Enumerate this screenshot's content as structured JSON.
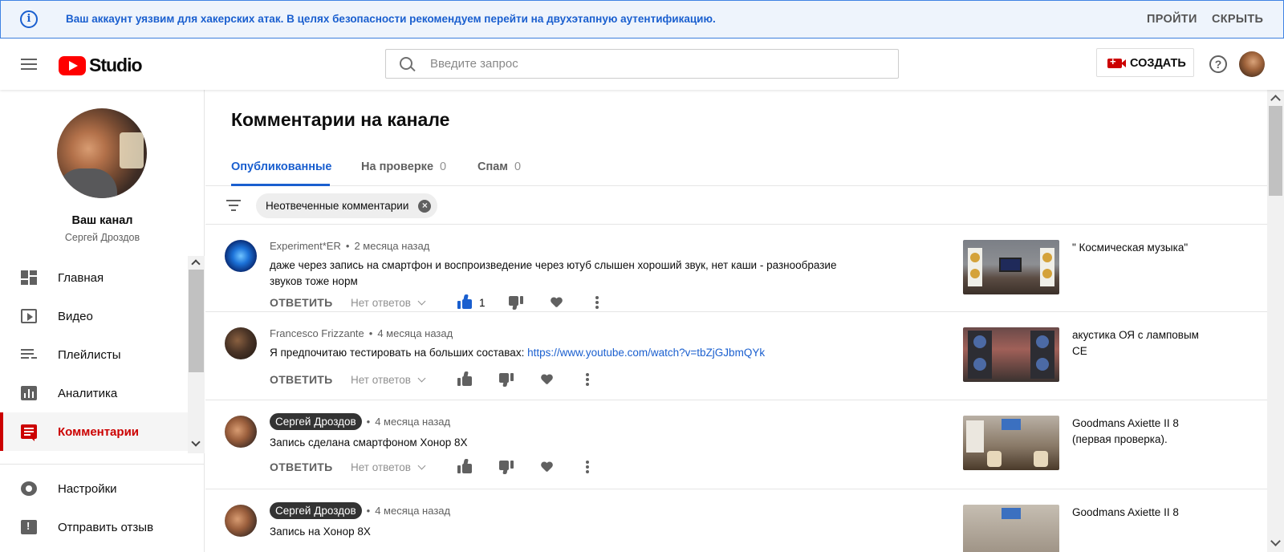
{
  "banner": {
    "message": "Ваш аккаунт уязвим для хакерских атак. В целях безопасности рекомендуем перейти на двухэтапную аутентификацию.",
    "go_label": "ПРОЙТИ",
    "hide_label": "СКРЫТЬ",
    "info_glyph": "i"
  },
  "header": {
    "logo_text": "Studio",
    "search_placeholder": "Введите запрос",
    "create_label": "СОЗДАТЬ",
    "help_glyph": "?"
  },
  "sidebar": {
    "channel_title": "Ваш канал",
    "channel_name": "Сергей Дроздов",
    "items": [
      {
        "label": "Главная"
      },
      {
        "label": "Видео"
      },
      {
        "label": "Плейлисты"
      },
      {
        "label": "Аналитика"
      },
      {
        "label": "Комментарии",
        "active": true
      }
    ],
    "bottom_items": [
      {
        "label": "Настройки"
      },
      {
        "label": "Отправить отзыв"
      }
    ]
  },
  "main": {
    "title": "Комментарии на канале",
    "tabs": [
      {
        "label": "Опубликованные",
        "count": ""
      },
      {
        "label": "На проверке",
        "count": "0"
      },
      {
        "label": "Спам",
        "count": "0"
      }
    ],
    "filter_chip": "Неотвеченные комментарии",
    "chip_close_glyph": "×",
    "reply_label": "ОТВЕТИТЬ",
    "no_replies_label": "Нет ответов",
    "comments": [
      {
        "author": "Experiment*ER",
        "time": "2 месяца назад",
        "text": "даже через запись на смартфон и воспроизведение через ютуб слышен хороший звук, нет каши - разнообразие звуков тоже норм",
        "likes": "1",
        "video_title": "\" Космическая музыка\""
      },
      {
        "author": "Francesco Frizzante",
        "time": "4 месяца назад",
        "text": "Я предпочитаю тестировать на больших составах: ",
        "link": "https://www.youtube.com/watch?v=tbZjGJbmQYk",
        "video_title": "акустика ОЯ с ламповым СЕ"
      },
      {
        "author": "Сергей Дроздов",
        "time": "4 месяца назад",
        "text": "Запись сделана смартфоном Хонор 8Х",
        "video_title": "Goodmans Axiette II 8 (первая проверка)."
      },
      {
        "author": "Сергей Дроздов",
        "time": "4 месяца назад",
        "text": "Запись на Хонор 8Х",
        "video_title": "Goodmans Axiette II 8"
      }
    ]
  },
  "colors": {
    "accent_blue": "#1a5fcf",
    "brand_red": "#cc0000",
    "banner_bg": "#eef4fc"
  }
}
